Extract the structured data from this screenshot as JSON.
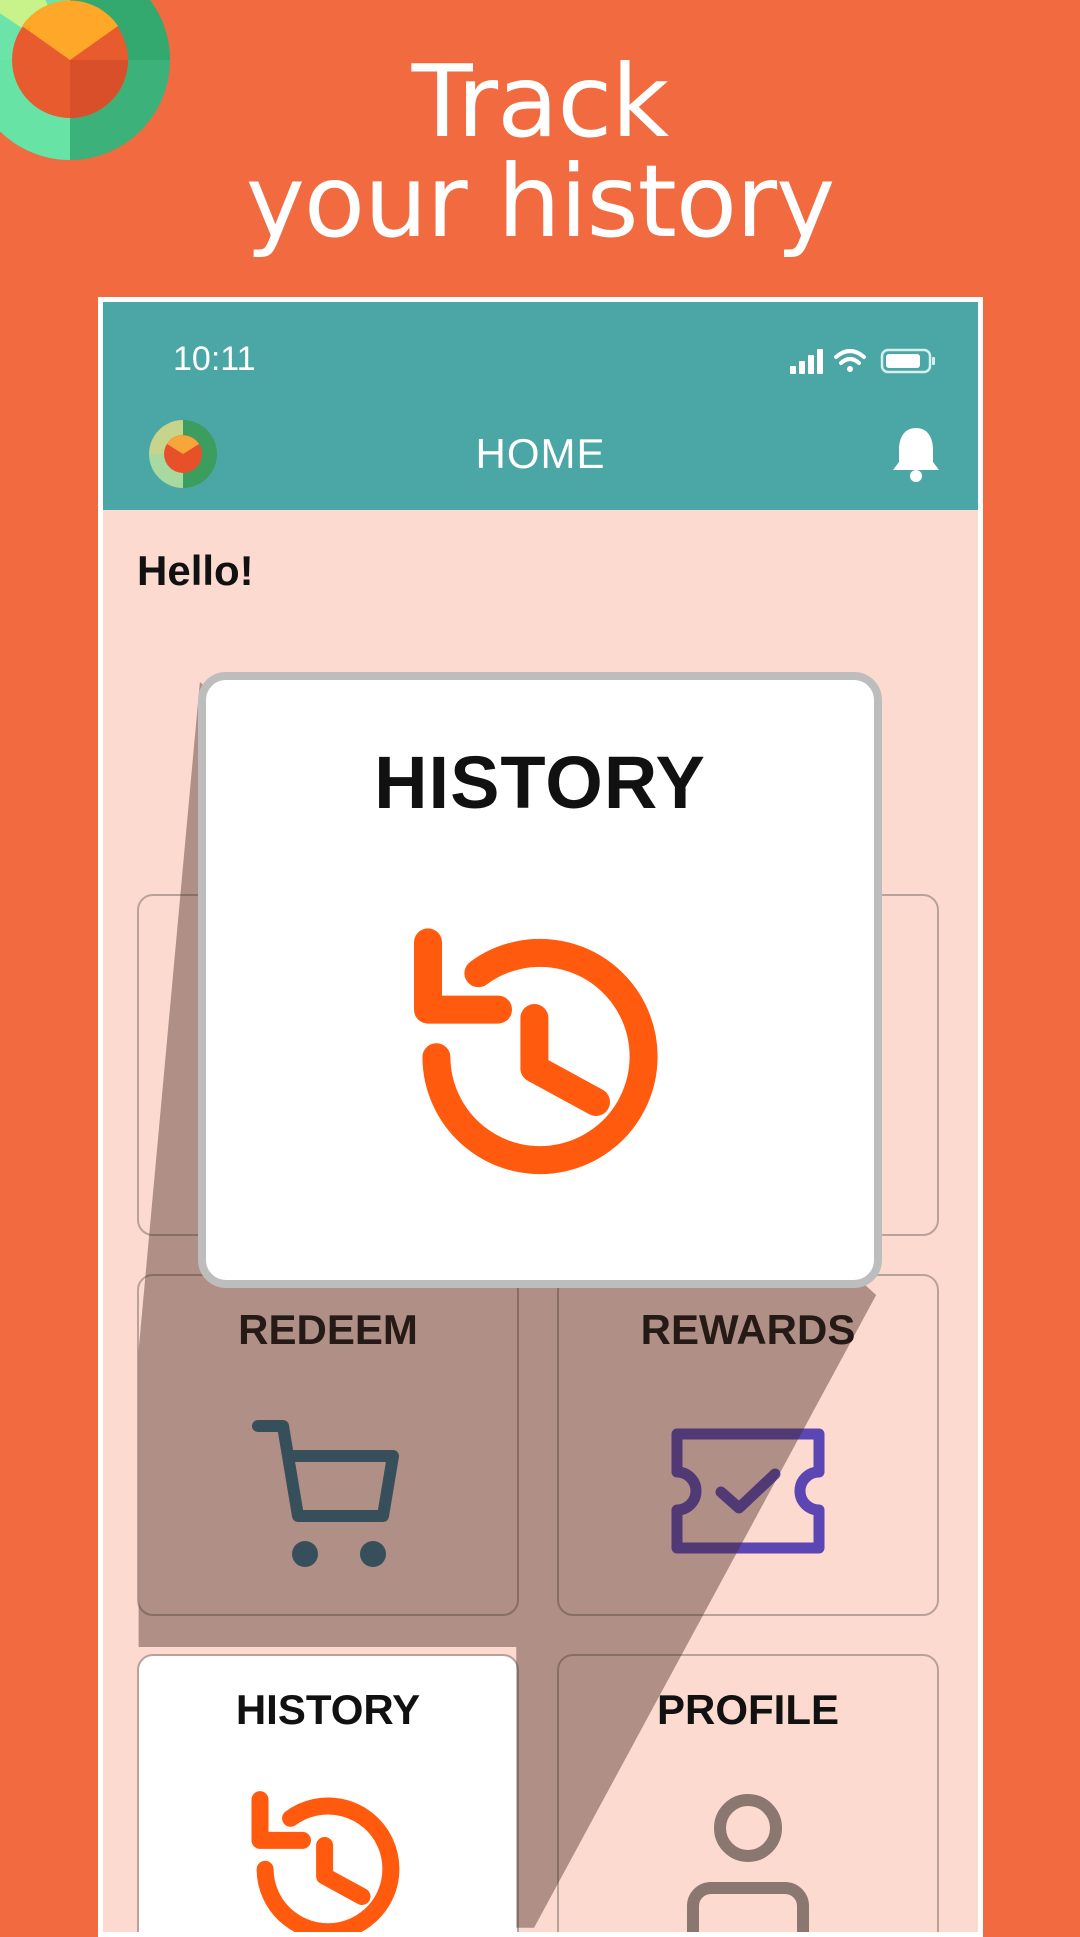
{
  "headline": {
    "line1": "Track",
    "line2": "your history"
  },
  "status_bar": {
    "time": "10:11"
  },
  "app_bar": {
    "title": "HOME",
    "logo_icon": "app-logo-icon",
    "notification_icon": "bell-icon"
  },
  "greeting": "Hello!",
  "tiles": [
    {
      "label": "REDEEM",
      "icon": "cart-icon",
      "icon_color": "#2E6B87"
    },
    {
      "label": "REWARDS",
      "icon": "ticket-check-icon",
      "icon_color": "#5B46B3"
    },
    {
      "label": "HISTORY",
      "icon": "history-icon",
      "icon_color": "#FF5A0E"
    },
    {
      "label": "PROFILE",
      "icon": "user-icon",
      "icon_color": "#8A7770"
    }
  ],
  "zoom_callout": {
    "label": "HISTORY",
    "icon": "history-icon"
  },
  "colors": {
    "background": "#F16A40",
    "appbar": "#4BA7A6",
    "screen": "#FCDAD0",
    "accent": "#FF5A0E"
  }
}
